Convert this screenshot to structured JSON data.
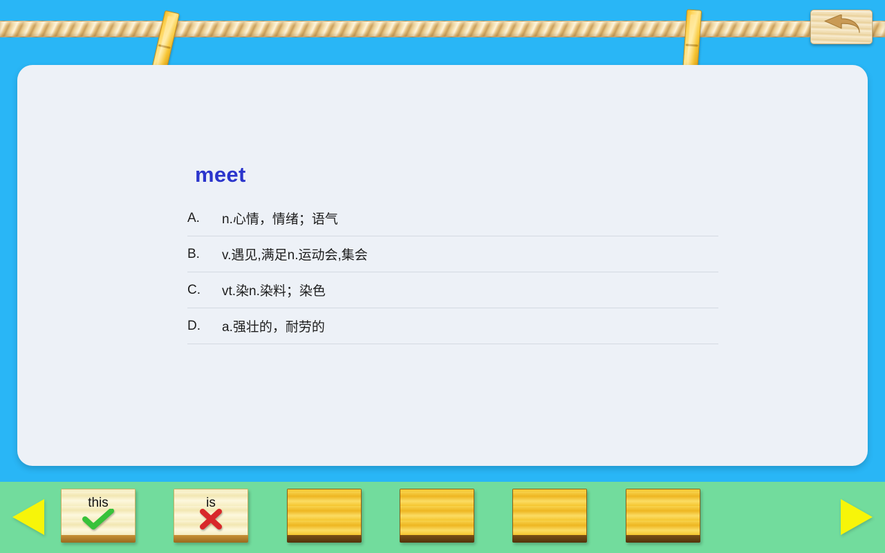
{
  "theme": {
    "background_blue": "#29b6f6",
    "card_background": "#edf1f7",
    "bottom_bar_green": "#72dc9d",
    "word_blue": "#2b35cc",
    "arrow_yellow": "#f7f509",
    "check_green": "#37c23a",
    "cross_red": "#d8282a"
  },
  "header": {
    "back_button_label": "Back",
    "back_icon": "undo-arrow-icon",
    "rope_label": "clothesline-rope",
    "clothespins": [
      "clothespin-left",
      "clothespin-right"
    ]
  },
  "quiz": {
    "word": "meet",
    "options": [
      {
        "letter": "A.",
        "text": "n.心情，情绪；语气"
      },
      {
        "letter": "B.",
        "text": "v.遇见,满足n.运动会,集会"
      },
      {
        "letter": "C.",
        "text": "vt.染n.染料；染色"
      },
      {
        "letter": "D.",
        "text": "a.强壮的，耐劳的"
      }
    ]
  },
  "footer": {
    "prev_label": "Previous",
    "next_label": "Next",
    "prev_icon": "triangle-left-icon",
    "next_icon": "triangle-right-icon",
    "cards": [
      {
        "word": "this",
        "status": "correct",
        "mark": "check-icon"
      },
      {
        "word": "is",
        "status": "incorrect",
        "mark": "cross-icon"
      },
      {
        "word": "",
        "status": "pending",
        "mark": ""
      },
      {
        "word": "",
        "status": "pending",
        "mark": ""
      },
      {
        "word": "",
        "status": "pending",
        "mark": ""
      },
      {
        "word": "",
        "status": "pending",
        "mark": ""
      }
    ]
  }
}
